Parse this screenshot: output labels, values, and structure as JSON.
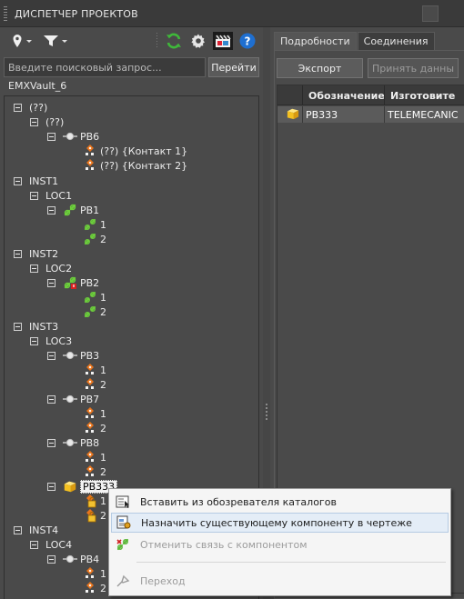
{
  "window": {
    "title": "ДИСПЕТЧЕР ПРОЕКТОВ"
  },
  "toolbar": {
    "icons": [
      "location-pin-icon",
      "filter-icon",
      "refresh-icon",
      "gear-icon",
      "clapperboard-icon",
      "help-icon"
    ]
  },
  "search": {
    "placeholder": "Введите поисковый запрос...",
    "go_label": "Перейти"
  },
  "vault_name": "EMXVault_6",
  "tree": {
    "nodes": [
      {
        "label": "(??)"
      },
      {
        "label": "(??)"
      },
      {
        "label": "PB6"
      },
      {
        "label": "(??) {Контакт 1}"
      },
      {
        "label": "(??) {Контакт 2}"
      },
      {
        "label": "INST1"
      },
      {
        "label": "LOC1"
      },
      {
        "label": "PB1"
      },
      {
        "label": "1"
      },
      {
        "label": "2"
      },
      {
        "label": "INST2"
      },
      {
        "label": "LOC2"
      },
      {
        "label": "PB2"
      },
      {
        "label": "1"
      },
      {
        "label": "2"
      },
      {
        "label": "INST3"
      },
      {
        "label": "LOC3"
      },
      {
        "label": "PB3"
      },
      {
        "label": "1"
      },
      {
        "label": "2"
      },
      {
        "label": "PB7"
      },
      {
        "label": "1"
      },
      {
        "label": "2"
      },
      {
        "label": "PB8"
      },
      {
        "label": "1"
      },
      {
        "label": "2"
      },
      {
        "label": "PB333"
      },
      {
        "label": "1"
      },
      {
        "label": "2"
      },
      {
        "label": "INST4"
      },
      {
        "label": "LOC4"
      },
      {
        "label": "PB4"
      },
      {
        "label": "1"
      },
      {
        "label": "2"
      }
    ]
  },
  "tabs": [
    {
      "label": "Подробности"
    },
    {
      "label": "Соединения"
    }
  ],
  "details": {
    "export_label": "Экспорт",
    "accept_label": "Принять данны",
    "columns": [
      "Обозначение",
      "Изготовите"
    ],
    "rows": [
      {
        "designation": "PB333",
        "manufacturer": "TELEMECANIC"
      }
    ]
  },
  "context_menu": {
    "items": [
      {
        "label": "Вставить из обозревателя каталогов",
        "enabled": true
      },
      {
        "label": "Назначить существующему компоненту в чертеже",
        "enabled": true,
        "highlighted": true
      },
      {
        "label": "Отменить связь с компонентом",
        "enabled": false
      },
      {
        "label": "Переход",
        "enabled": false
      }
    ]
  },
  "colors": {
    "background": "#4a4a4a",
    "accent_orange": "#e8741c",
    "link_green": "#6ccf3b",
    "selection": "#f2f2f2"
  }
}
